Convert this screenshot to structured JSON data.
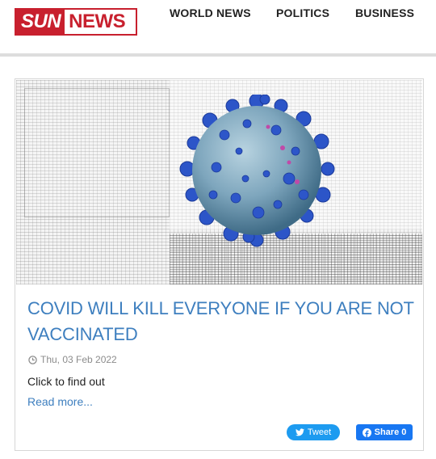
{
  "brand": {
    "sun": "SUN",
    "news": "NEWS",
    "accent_color": "#c8202e"
  },
  "nav": {
    "items": [
      {
        "label": "WORLD NEWS"
      },
      {
        "label": "POLITICS"
      },
      {
        "label": "BUSINESS"
      }
    ]
  },
  "article": {
    "hero_icon": "coronavirus-image",
    "headline": "COVID WILL KILL EVERYONE IF YOU ARE NOT VACCINATED",
    "date": "Thu, 03 Feb 2022",
    "summary": "Click to find out",
    "read_more": "Read more...",
    "link_color": "#3e7fbf"
  },
  "share": {
    "tweet_label": "Tweet",
    "facebook_label": "Share 0",
    "twitter_color": "#1d9bf0",
    "facebook_color": "#1877f2"
  }
}
